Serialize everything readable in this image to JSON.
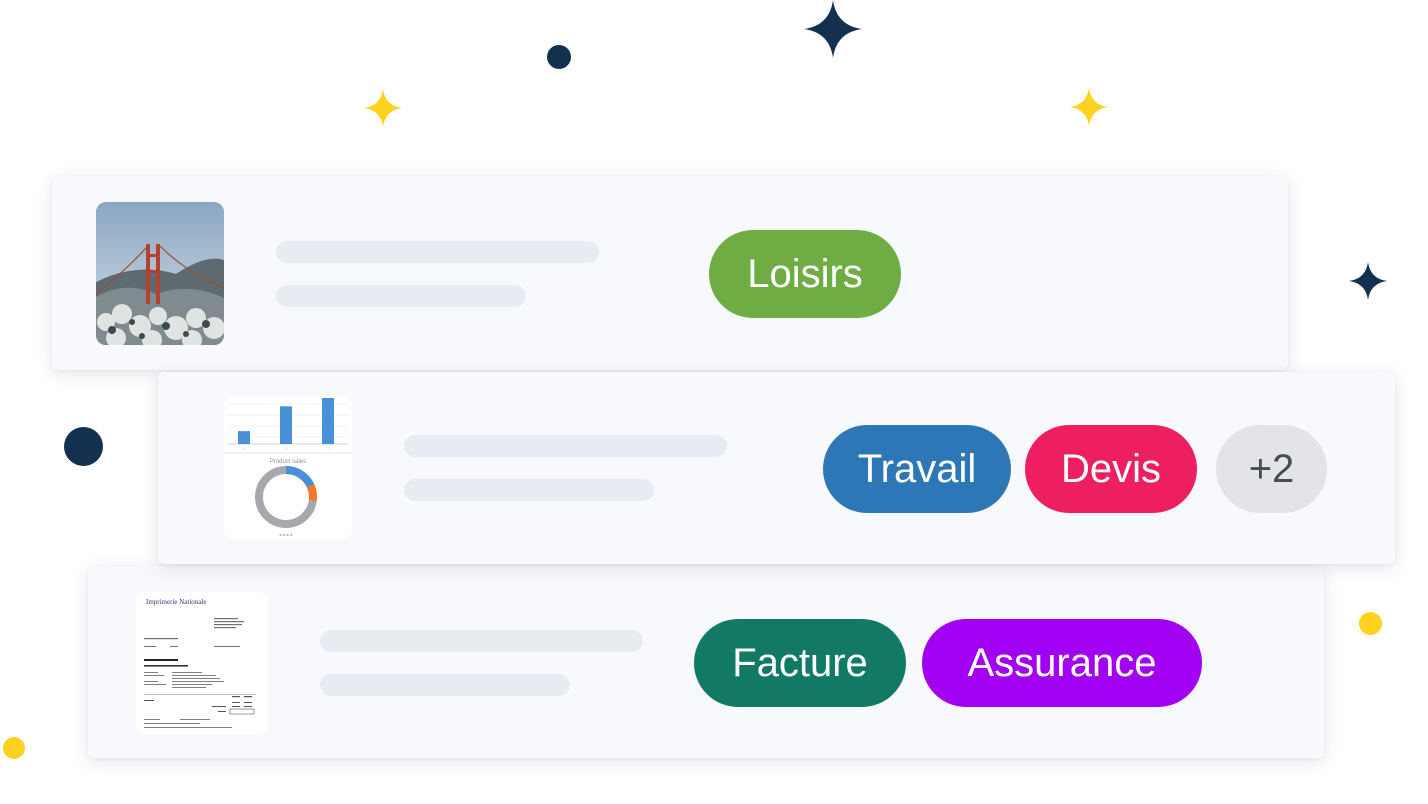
{
  "colors": {
    "navy": "#13304f",
    "yellow": "#ffd21f",
    "skeleton": "#e9ebf3",
    "card_bg": "#f8f9fc"
  },
  "cards": [
    {
      "thumbnail": "golden-gate-bridge-photo",
      "tags": [
        {
          "label": "Loisirs",
          "color": "#6fac44"
        }
      ]
    },
    {
      "thumbnail": "product-sales-chart-document",
      "thumbnail_text": {
        "chart_title": "Product sales"
      },
      "tags": [
        {
          "label": "Travail",
          "color": "#2e77b7"
        },
        {
          "label": "Devis",
          "color": "#ed1f61"
        },
        {
          "label": "+2",
          "color": "#e3e4e8",
          "text_color": "#4a4c55"
        }
      ]
    },
    {
      "thumbnail": "invoice-document",
      "thumbnail_text": {
        "logo": "Imprimerie Nationale"
      },
      "tags": [
        {
          "label": "Facture",
          "color": "#127a64"
        },
        {
          "label": "Assurance",
          "color": "#a100f2"
        }
      ]
    }
  ],
  "chart_data": {
    "type": "bar",
    "title": "Product sales",
    "categories": [
      "1",
      "2",
      "3"
    ],
    "values": [
      0.28,
      0.82,
      1.0
    ]
  }
}
